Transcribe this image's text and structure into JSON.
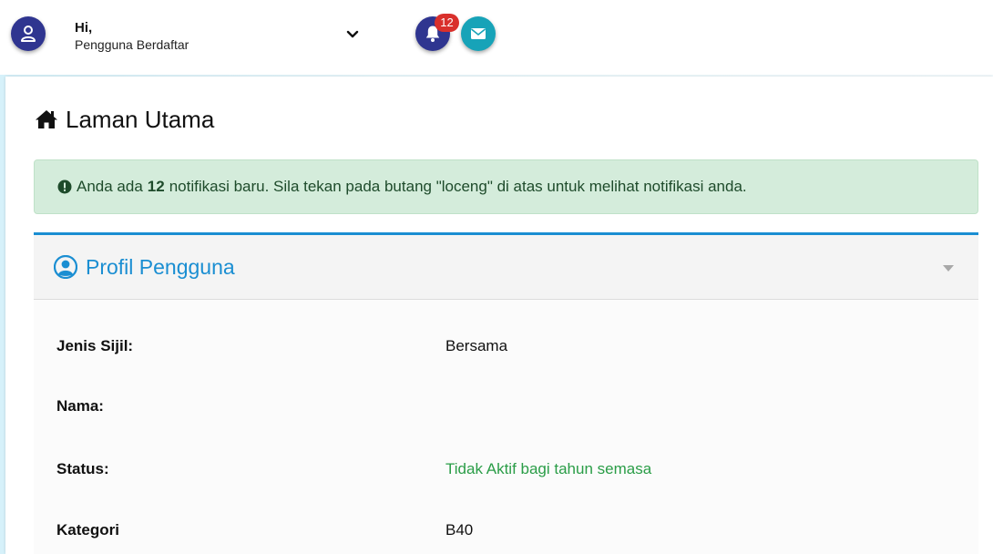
{
  "header": {
    "greeting": "Hi,",
    "user_label": "Pengguna Berdaftar",
    "notification_count": "12",
    "colors": {
      "primary": "#2f3590",
      "mail": "#17a3b8",
      "badge": "#d9302c"
    }
  },
  "page": {
    "title": "Laman Utama"
  },
  "alert": {
    "prefix": "Anda ada",
    "count": "12",
    "suffix": "notifikasi baru. Sila tekan pada butang \"loceng\" di atas untuk melihat notifikasi anda."
  },
  "profile": {
    "title": "Profil Pengguna",
    "accent": "#1a8ed2",
    "fields": [
      {
        "label": "Jenis Sijil:",
        "value": "Bersama"
      },
      {
        "label": "Nama:",
        "value": ""
      },
      {
        "label": "Status:",
        "value": "Tidak Aktif bagi tahun semasa",
        "color": "#2a9d47"
      },
      {
        "label": "Kategori",
        "value": "B40"
      }
    ]
  }
}
